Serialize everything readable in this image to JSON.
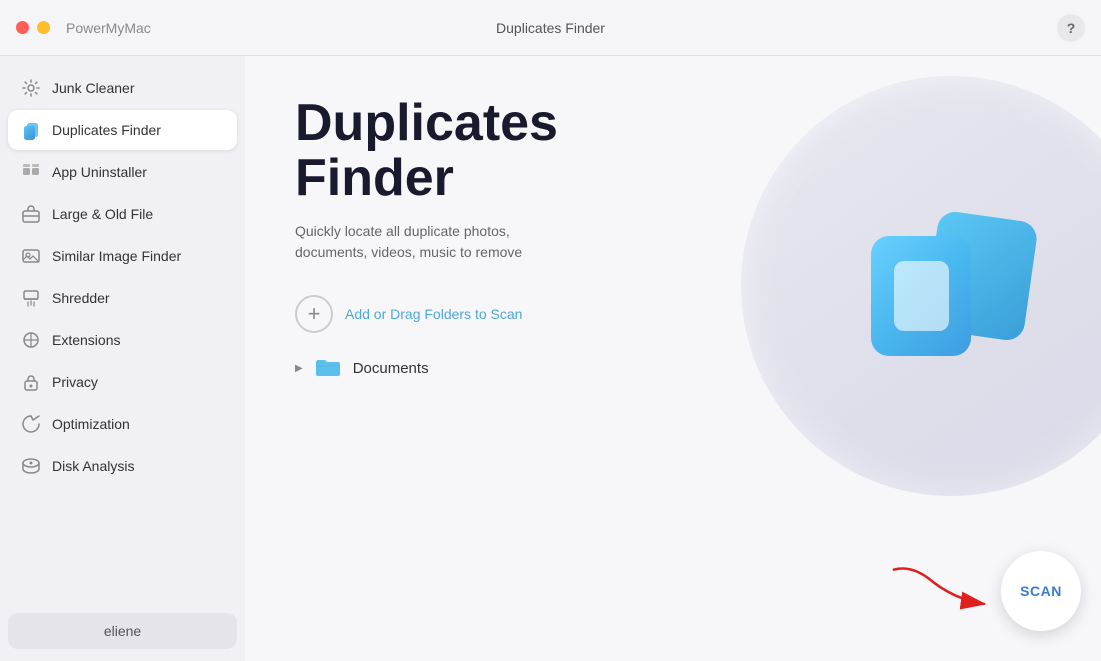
{
  "titlebar": {
    "app_name": "PowerMyMac",
    "center_title": "Duplicates Finder",
    "help_label": "?"
  },
  "sidebar": {
    "items": [
      {
        "id": "junk-cleaner",
        "label": "Junk Cleaner",
        "icon": "gear-icon"
      },
      {
        "id": "duplicates-finder",
        "label": "Duplicates Finder",
        "icon": "duplicate-icon",
        "active": true
      },
      {
        "id": "app-uninstaller",
        "label": "App Uninstaller",
        "icon": "app-icon"
      },
      {
        "id": "large-old-file",
        "label": "Large & Old File",
        "icon": "briefcase-icon"
      },
      {
        "id": "similar-image-finder",
        "label": "Similar Image Finder",
        "icon": "image-icon"
      },
      {
        "id": "shredder",
        "label": "Shredder",
        "icon": "shredder-icon"
      },
      {
        "id": "extensions",
        "label": "Extensions",
        "icon": "extensions-icon"
      },
      {
        "id": "privacy",
        "label": "Privacy",
        "icon": "privacy-icon"
      },
      {
        "id": "optimization",
        "label": "Optimization",
        "icon": "optimization-icon"
      },
      {
        "id": "disk-analysis",
        "label": "Disk Analysis",
        "icon": "disk-icon"
      }
    ],
    "user_label": "eliene"
  },
  "content": {
    "title": "Duplicates\nFinder",
    "description": "Quickly locate all duplicate photos,\ndocuments, videos, music to remove",
    "add_folder_text": "Add or Drag Folders to Scan",
    "folder_item": "Documents",
    "scan_label": "SCAN"
  }
}
